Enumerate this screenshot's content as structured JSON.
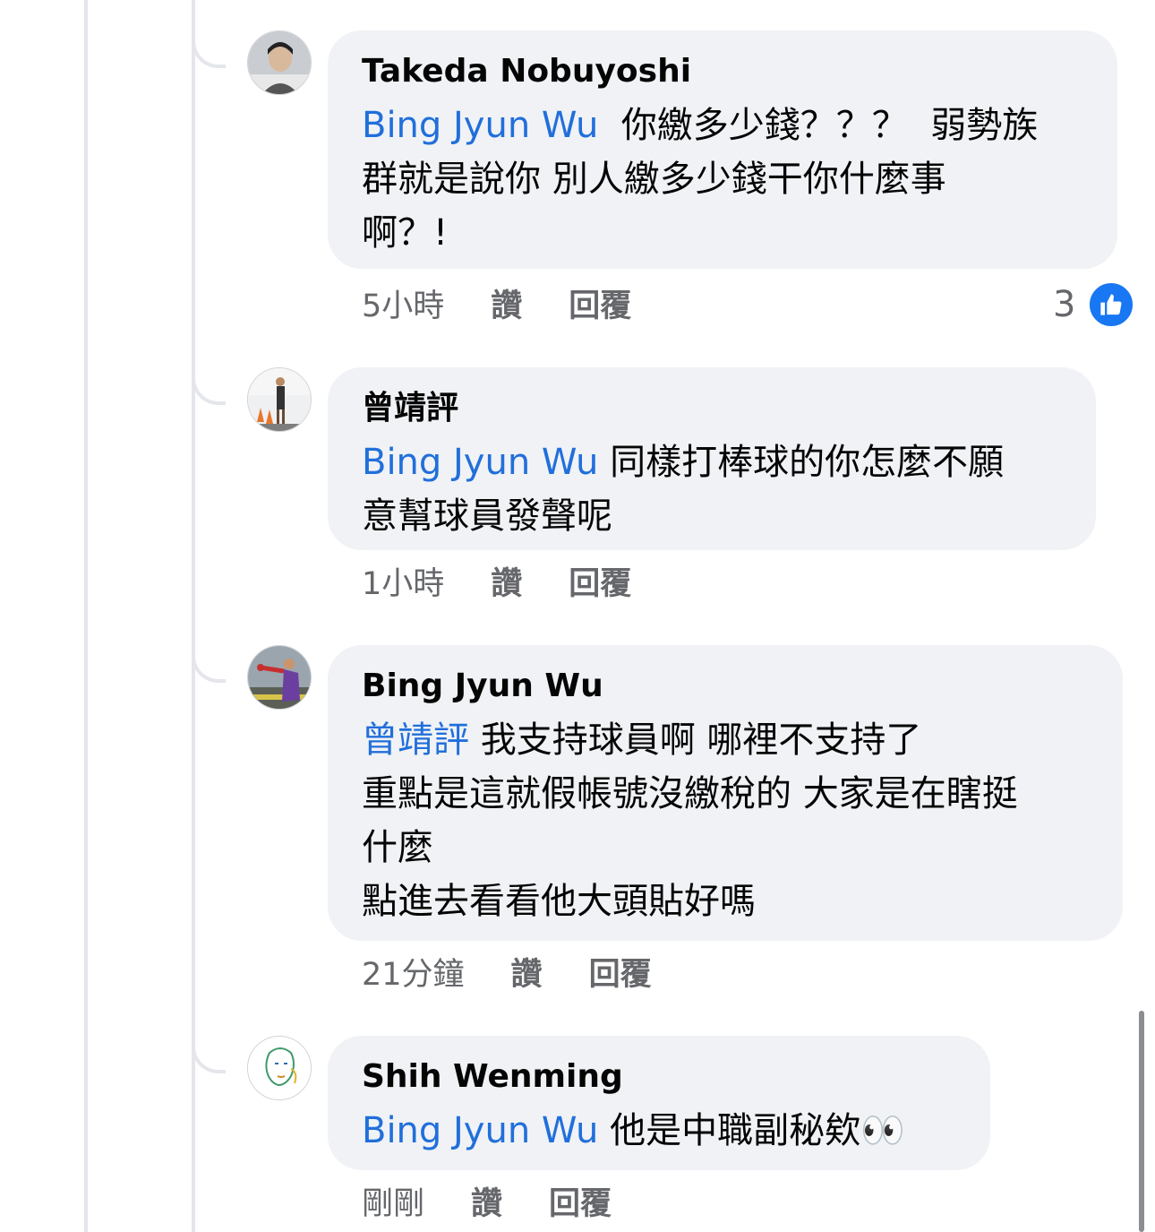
{
  "comments": [
    {
      "author": "Takeda Nobuyoshi",
      "mention": "Bing Jyun Wu",
      "text": "  你繳多少錢？？？  弱勢族\n群就是說你 別人繳多少錢干你什麼事\n啊？!",
      "time": "5小時",
      "like": "讚",
      "reply": "回覆",
      "reaction_count": "3"
    },
    {
      "author": "曾靖評",
      "mention": "Bing Jyun Wu",
      "text": " 同樣打棒球的你怎麼不願\n意幫球員發聲呢",
      "time": "1小時",
      "like": "讚",
      "reply": "回覆"
    },
    {
      "author": "Bing Jyun Wu",
      "mention": "曾靖評",
      "text": " 我支持球員啊 哪裡不支持了\n重點是這就假帳號沒繳稅的 大家是在瞎挺\n什麼\n點進去看看他大頭貼好嗎",
      "time": "21分鐘",
      "like": "讚",
      "reply": "回覆"
    },
    {
      "author": "Shih Wenming",
      "mention": "Bing Jyun Wu",
      "text": " 他是中職副秘欸👀",
      "time": "剛剛",
      "like": "讚",
      "reply": "回覆"
    }
  ],
  "colors": {
    "mention": "#216fdb",
    "bubble": "#f0f2f5",
    "like_badge": "#1877f2"
  }
}
